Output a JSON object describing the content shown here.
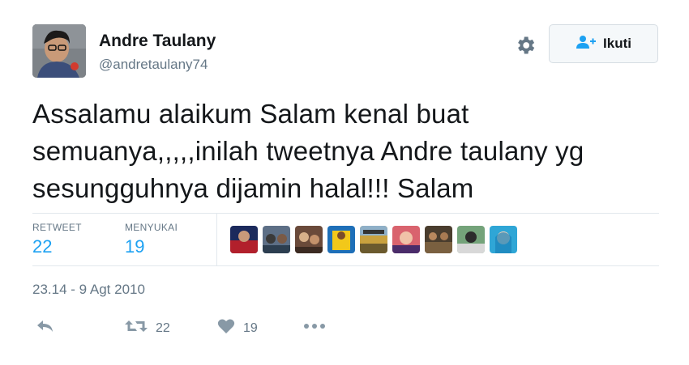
{
  "user": {
    "display_name": "Andre Taulany",
    "handle": "@andretaulany74"
  },
  "follow_button": {
    "label": "Ikuti",
    "icon": "add-user-icon"
  },
  "settings": {
    "icon": "gear-icon"
  },
  "tweet": {
    "text": "Assalamu alaikum Salam kenal buat semuanya,,,,,inilah tweetnya Andre taulany yg sesungguhnya dijamin halal!!! Salam"
  },
  "stats": {
    "retweets_label": "RETWEET",
    "retweets_value": "22",
    "likes_label": "MENYUKAI",
    "likes_value": "19"
  },
  "timestamp": "23.14 - 9 Agt 2010",
  "actions": {
    "reply_icon": "reply-icon",
    "retweet_icon": "retweet-icon",
    "retweet_count": "22",
    "like_icon": "heart-icon",
    "like_count": "19",
    "more_icon": "more-icon"
  },
  "colors": {
    "accent": "#1da1f2",
    "muted": "#657786",
    "text": "#14171a",
    "border": "#e1e8ed"
  }
}
